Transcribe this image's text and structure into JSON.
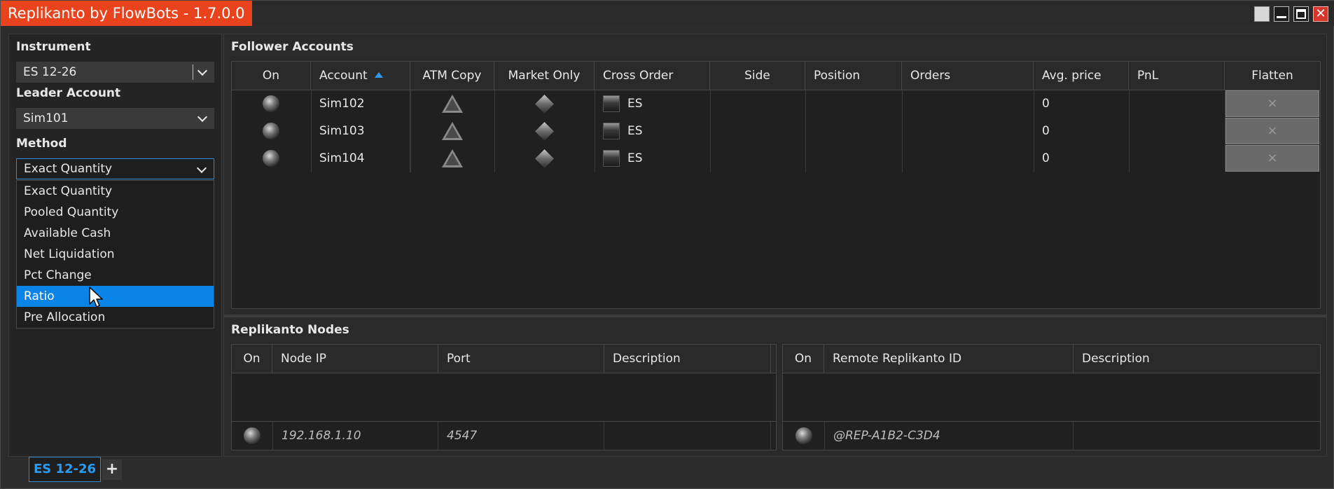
{
  "window": {
    "title": "Replikanto by FlowBots - 1.7.0.0"
  },
  "left_panel": {
    "instrument_label": "Instrument",
    "instrument_value": "ES 12-26",
    "leader_label": "Leader Account",
    "leader_value": "Sim101",
    "method_label": "Method",
    "method_value": "Exact Quantity",
    "method_options": [
      "Exact Quantity",
      "Pooled Quantity",
      "Available Cash",
      "Net Liquidation",
      "Pct Change",
      "Ratio",
      "Pre Allocation"
    ],
    "method_highlighted": "Ratio"
  },
  "followers": {
    "title": "Follower Accounts",
    "columns": [
      "On",
      "Account",
      "ATM Copy",
      "Market Only",
      "Cross Order",
      "Side",
      "Position",
      "Orders",
      "Avg. price",
      "PnL",
      "Flatten"
    ],
    "sorted_column": "Account",
    "sort_direction": "ascending",
    "rows": [
      {
        "account": "Sim102",
        "cross_order": "ES",
        "side": "",
        "position": "",
        "orders": "",
        "avg_price": "0",
        "pnl": "",
        "flatten": "×"
      },
      {
        "account": "Sim103",
        "cross_order": "ES",
        "side": "",
        "position": "",
        "orders": "",
        "avg_price": "0",
        "pnl": "",
        "flatten": "×"
      },
      {
        "account": "Sim104",
        "cross_order": "ES",
        "side": "",
        "position": "",
        "orders": "",
        "avg_price": "0",
        "pnl": "",
        "flatten": "×"
      }
    ]
  },
  "nodes": {
    "title": "Replikanto Nodes",
    "left_columns": [
      "On",
      "Node IP",
      "Port",
      "Description"
    ],
    "left_new_row": {
      "ip": "192.168.1.10",
      "port": "4547",
      "description": ""
    },
    "right_columns": [
      "On",
      "Remote Replikanto ID",
      "Description"
    ],
    "right_new_row": {
      "remote_id": "@REP-A1B2-C3D4",
      "description": ""
    }
  },
  "tabs": {
    "active": "ES 12-26",
    "add": "+"
  },
  "colors": {
    "title_bg": "#e8431c",
    "accent": "#0a84e6",
    "close": "#d8362a"
  }
}
